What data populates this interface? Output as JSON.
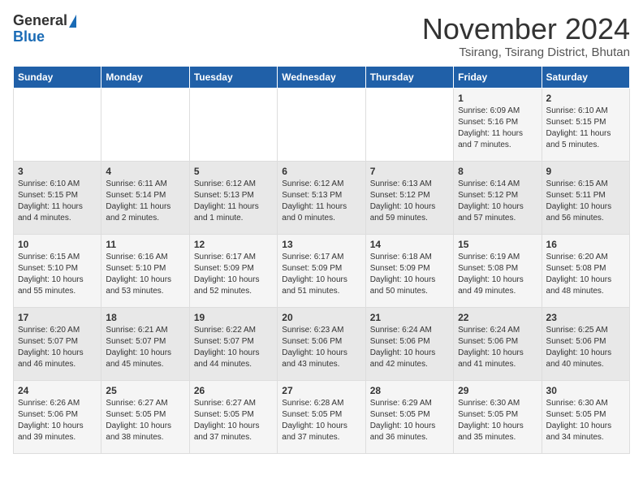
{
  "header": {
    "logo_line1": "General",
    "logo_line2": "Blue",
    "title": "November 2024",
    "subtitle": "Tsirang, Tsirang District, Bhutan"
  },
  "days_of_week": [
    "Sunday",
    "Monday",
    "Tuesday",
    "Wednesday",
    "Thursday",
    "Friday",
    "Saturday"
  ],
  "weeks": [
    [
      {
        "day": "",
        "content": ""
      },
      {
        "day": "",
        "content": ""
      },
      {
        "day": "",
        "content": ""
      },
      {
        "day": "",
        "content": ""
      },
      {
        "day": "",
        "content": ""
      },
      {
        "day": "1",
        "content": "Sunrise: 6:09 AM\nSunset: 5:16 PM\nDaylight: 11 hours and 7 minutes."
      },
      {
        "day": "2",
        "content": "Sunrise: 6:10 AM\nSunset: 5:15 PM\nDaylight: 11 hours and 5 minutes."
      }
    ],
    [
      {
        "day": "3",
        "content": "Sunrise: 6:10 AM\nSunset: 5:15 PM\nDaylight: 11 hours and 4 minutes."
      },
      {
        "day": "4",
        "content": "Sunrise: 6:11 AM\nSunset: 5:14 PM\nDaylight: 11 hours and 2 minutes."
      },
      {
        "day": "5",
        "content": "Sunrise: 6:12 AM\nSunset: 5:13 PM\nDaylight: 11 hours and 1 minute."
      },
      {
        "day": "6",
        "content": "Sunrise: 6:12 AM\nSunset: 5:13 PM\nDaylight: 11 hours and 0 minutes."
      },
      {
        "day": "7",
        "content": "Sunrise: 6:13 AM\nSunset: 5:12 PM\nDaylight: 10 hours and 59 minutes."
      },
      {
        "day": "8",
        "content": "Sunrise: 6:14 AM\nSunset: 5:12 PM\nDaylight: 10 hours and 57 minutes."
      },
      {
        "day": "9",
        "content": "Sunrise: 6:15 AM\nSunset: 5:11 PM\nDaylight: 10 hours and 56 minutes."
      }
    ],
    [
      {
        "day": "10",
        "content": "Sunrise: 6:15 AM\nSunset: 5:10 PM\nDaylight: 10 hours and 55 minutes."
      },
      {
        "day": "11",
        "content": "Sunrise: 6:16 AM\nSunset: 5:10 PM\nDaylight: 10 hours and 53 minutes."
      },
      {
        "day": "12",
        "content": "Sunrise: 6:17 AM\nSunset: 5:09 PM\nDaylight: 10 hours and 52 minutes."
      },
      {
        "day": "13",
        "content": "Sunrise: 6:17 AM\nSunset: 5:09 PM\nDaylight: 10 hours and 51 minutes."
      },
      {
        "day": "14",
        "content": "Sunrise: 6:18 AM\nSunset: 5:09 PM\nDaylight: 10 hours and 50 minutes."
      },
      {
        "day": "15",
        "content": "Sunrise: 6:19 AM\nSunset: 5:08 PM\nDaylight: 10 hours and 49 minutes."
      },
      {
        "day": "16",
        "content": "Sunrise: 6:20 AM\nSunset: 5:08 PM\nDaylight: 10 hours and 48 minutes."
      }
    ],
    [
      {
        "day": "17",
        "content": "Sunrise: 6:20 AM\nSunset: 5:07 PM\nDaylight: 10 hours and 46 minutes."
      },
      {
        "day": "18",
        "content": "Sunrise: 6:21 AM\nSunset: 5:07 PM\nDaylight: 10 hours and 45 minutes."
      },
      {
        "day": "19",
        "content": "Sunrise: 6:22 AM\nSunset: 5:07 PM\nDaylight: 10 hours and 44 minutes."
      },
      {
        "day": "20",
        "content": "Sunrise: 6:23 AM\nSunset: 5:06 PM\nDaylight: 10 hours and 43 minutes."
      },
      {
        "day": "21",
        "content": "Sunrise: 6:24 AM\nSunset: 5:06 PM\nDaylight: 10 hours and 42 minutes."
      },
      {
        "day": "22",
        "content": "Sunrise: 6:24 AM\nSunset: 5:06 PM\nDaylight: 10 hours and 41 minutes."
      },
      {
        "day": "23",
        "content": "Sunrise: 6:25 AM\nSunset: 5:06 PM\nDaylight: 10 hours and 40 minutes."
      }
    ],
    [
      {
        "day": "24",
        "content": "Sunrise: 6:26 AM\nSunset: 5:06 PM\nDaylight: 10 hours and 39 minutes."
      },
      {
        "day": "25",
        "content": "Sunrise: 6:27 AM\nSunset: 5:05 PM\nDaylight: 10 hours and 38 minutes."
      },
      {
        "day": "26",
        "content": "Sunrise: 6:27 AM\nSunset: 5:05 PM\nDaylight: 10 hours and 37 minutes."
      },
      {
        "day": "27",
        "content": "Sunrise: 6:28 AM\nSunset: 5:05 PM\nDaylight: 10 hours and 37 minutes."
      },
      {
        "day": "28",
        "content": "Sunrise: 6:29 AM\nSunset: 5:05 PM\nDaylight: 10 hours and 36 minutes."
      },
      {
        "day": "29",
        "content": "Sunrise: 6:30 AM\nSunset: 5:05 PM\nDaylight: 10 hours and 35 minutes."
      },
      {
        "day": "30",
        "content": "Sunrise: 6:30 AM\nSunset: 5:05 PM\nDaylight: 10 hours and 34 minutes."
      }
    ]
  ]
}
